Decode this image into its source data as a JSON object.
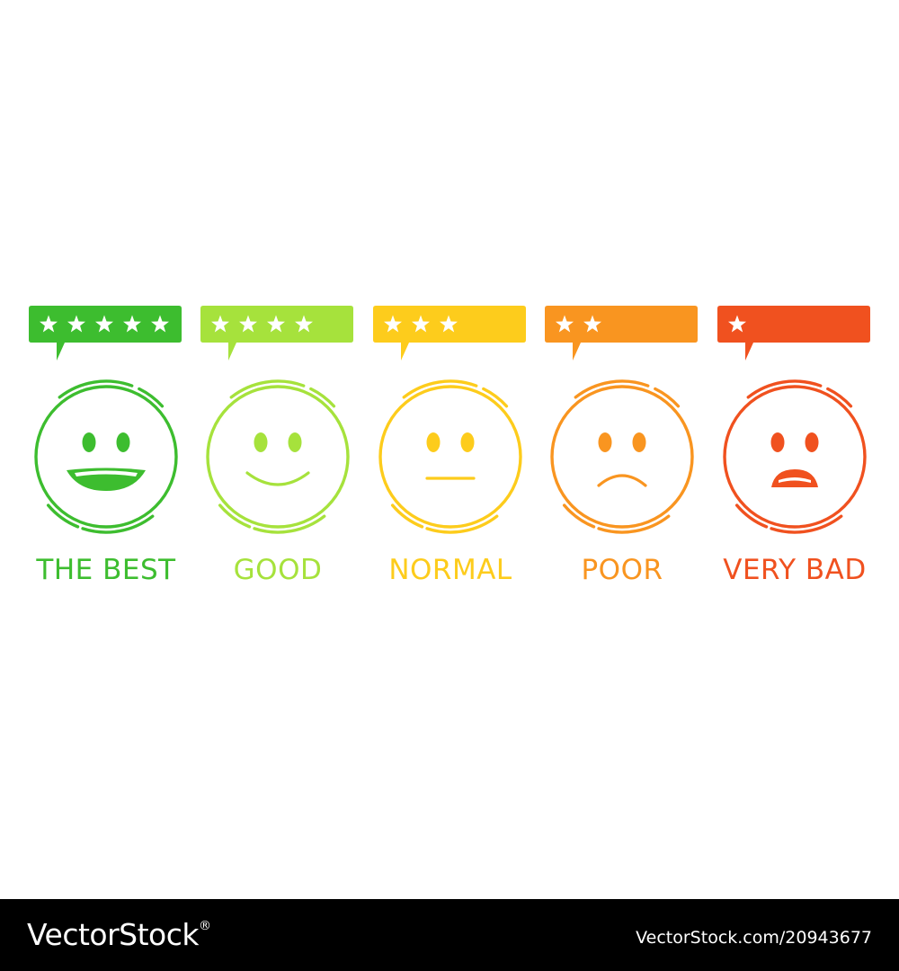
{
  "ratings": [
    {
      "label": "THE BEST",
      "stars": 5,
      "mood": "big-smile",
      "color": "#3dbd2f"
    },
    {
      "label": "GOOD",
      "stars": 4,
      "mood": "smile",
      "color": "#a6e23c"
    },
    {
      "label": "NORMAL",
      "stars": 3,
      "mood": "neutral",
      "color": "#fdcc1c"
    },
    {
      "label": "POOR",
      "stars": 2,
      "mood": "frown",
      "color": "#f99520"
    },
    {
      "label": "VERY BAD",
      "stars": 1,
      "mood": "upset",
      "color": "#f0511f"
    }
  ],
  "footer": {
    "brand": "VectorStock",
    "registered_mark": "®",
    "image_id": "VectorStock.com/20943677",
    "background": "#000000",
    "text_color": "#ffffff"
  }
}
